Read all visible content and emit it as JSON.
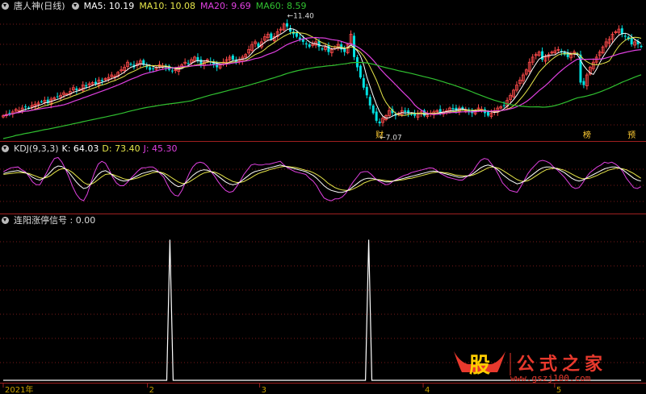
{
  "main_header": {
    "stock_name": "唐人神(日线)",
    "ma5": "MA5: 10.19",
    "ma10": "MA10: 10.08",
    "ma20": "MA20: 9.69",
    "ma60": "MA60: 8.59"
  },
  "kdj_header": {
    "title": "KDJ(9,3,3)",
    "k": "K: 64.03",
    "d": "D: 73.40",
    "j": "J: 45.30"
  },
  "signal_header": {
    "title": "连阳涨停信号 : 0.00"
  },
  "colors": {
    "up": "#ff4a4a",
    "down": "#00e0e0",
    "ma5": "#ffffff",
    "ma10": "#e6e64a",
    "ma20": "#e040e0",
    "ma60": "#30c030",
    "k": "#ffffff",
    "d": "#e6e64a",
    "j": "#e040e0",
    "grid": "#7a1a1a",
    "axis": "#a02020"
  },
  "chart_data": [
    {
      "type": "candlestick",
      "title": "唐人神(日线)",
      "price_range": [
        6.8,
        11.8
      ],
      "annotations": [
        {
          "label": "11.40",
          "value": 11.4,
          "index": 88
        },
        {
          "label": "7.07",
          "value": 7.07,
          "index": 117
        },
        {
          "label": "财",
          "index": 118
        },
        {
          "label": "榜",
          "index": 183
        },
        {
          "label": "预",
          "index": 197
        }
      ],
      "closes": [
        7.7,
        7.75,
        7.8,
        7.85,
        7.95,
        7.9,
        8.0,
        8.05,
        8.0,
        8.1,
        8.15,
        8.2,
        8.25,
        8.3,
        8.2,
        8.35,
        8.4,
        8.45,
        8.5,
        8.6,
        8.55,
        8.65,
        8.8,
        8.7,
        8.75,
        8.9,
        8.85,
        8.95,
        9.0,
        8.95,
        9.1,
        9.05,
        9.15,
        9.2,
        9.3,
        9.25,
        9.4,
        9.5,
        9.6,
        9.8,
        9.7,
        9.6,
        9.75,
        9.85,
        9.7,
        9.6,
        9.5,
        9.55,
        9.6,
        9.7,
        9.65,
        9.6,
        9.5,
        9.45,
        9.5,
        9.6,
        9.7,
        9.8,
        9.75,
        9.9,
        10.0,
        9.85,
        9.7,
        9.8,
        9.9,
        9.8,
        9.7,
        9.6,
        9.7,
        9.8,
        9.9,
        10.0,
        9.9,
        9.8,
        9.9,
        10.0,
        10.1,
        10.3,
        10.5,
        10.6,
        10.4,
        10.6,
        10.8,
        10.9,
        10.7,
        10.8,
        11.0,
        11.1,
        11.3,
        11.2,
        11.0,
        10.9,
        10.8,
        10.7,
        10.6,
        10.5,
        10.4,
        10.5,
        10.6,
        10.4,
        10.3,
        10.4,
        10.2,
        10.3,
        10.4,
        10.5,
        10.3,
        10.2,
        10.5,
        10.9,
        10.0,
        9.6,
        9.2,
        8.8,
        8.5,
        8.1,
        7.8,
        7.5,
        7.4,
        7.6,
        7.7,
        7.9,
        7.8,
        7.7,
        7.8,
        7.9,
        7.85,
        7.8,
        7.75,
        7.7,
        7.8,
        7.85,
        7.7,
        7.75,
        7.8,
        7.85,
        7.9,
        7.8,
        7.85,
        7.9,
        8.0,
        7.95,
        7.9,
        8.0,
        7.95,
        7.9,
        7.85,
        7.8,
        7.9,
        8.0,
        7.95,
        7.8,
        7.7,
        7.8,
        7.9,
        8.0,
        8.05,
        8.1,
        8.3,
        8.5,
        8.7,
        8.9,
        9.1,
        9.3,
        9.5,
        9.8,
        10.0,
        10.1,
        10.2,
        9.9,
        10.0,
        10.1,
        10.2,
        10.25,
        10.3,
        10.2,
        10.1,
        10.0,
        10.1,
        10.2,
        10.1,
        9.0,
        8.9,
        9.3,
        9.6,
        9.8,
        10.0,
        10.2,
        10.4,
        10.6,
        10.7,
        10.9,
        11.0,
        11.1,
        10.9,
        10.8,
        10.7,
        10.5,
        10.6,
        10.5,
        10.4
      ]
    },
    {
      "type": "line",
      "title": "KDJ(9,3,3)",
      "series": [
        {
          "name": "K"
        },
        {
          "name": "D"
        },
        {
          "name": "J"
        }
      ],
      "ylim": [
        -10,
        110
      ],
      "k": [
        70,
        72,
        74,
        75,
        76,
        74,
        72,
        68,
        62,
        58,
        56,
        60,
        66,
        74,
        82,
        86,
        85,
        80,
        72,
        62,
        52,
        44,
        38,
        40,
        48,
        58,
        68,
        74,
        76,
        72,
        66,
        60,
        56,
        54,
        55,
        58,
        62,
        66,
        70,
        72,
        74,
        76,
        75,
        72,
        68,
        60,
        52,
        46,
        42,
        44,
        50,
        58,
        66,
        72,
        76,
        78,
        77,
        74,
        70,
        64,
        58,
        52,
        48,
        46,
        48,
        52,
        58,
        64,
        70,
        74,
        76,
        78,
        80,
        82,
        84,
        86,
        88,
        86,
        84,
        82,
        80,
        78,
        76,
        74,
        70,
        66,
        60,
        52,
        44,
        38,
        34,
        32,
        30,
        30,
        32,
        36,
        42,
        48,
        54,
        58,
        60,
        60,
        58,
        56,
        54,
        52,
        52,
        54,
        56,
        58,
        60,
        62,
        64,
        66,
        68,
        70,
        72,
        74,
        75,
        74,
        72,
        70,
        68,
        66,
        64,
        62,
        62,
        64,
        66,
        70,
        76,
        82,
        86,
        88,
        86,
        82,
        76,
        68,
        62,
        56,
        52,
        48,
        50,
        54,
        60,
        66,
        72,
        78,
        82,
        84,
        84,
        82,
        80,
        76,
        72,
        66,
        60,
        56,
        54,
        56,
        60,
        64,
        68,
        72,
        76,
        80,
        82,
        84,
        84,
        82,
        78,
        72,
        66,
        60,
        56,
        54
      ],
      "d": [
        68,
        69,
        70,
        71,
        72,
        72,
        71,
        70,
        67,
        64,
        61,
        60,
        62,
        66,
        72,
        77,
        80,
        80,
        77,
        72,
        65,
        58,
        51,
        47,
        47,
        51,
        57,
        63,
        68,
        69,
        68,
        65,
        62,
        59,
        57,
        57,
        59,
        61,
        64,
        67,
        69,
        72,
        73,
        73,
        71,
        67,
        62,
        57,
        52,
        49,
        49,
        52,
        57,
        62,
        67,
        71,
        73,
        74,
        73,
        70,
        66,
        61,
        57,
        53,
        51,
        51,
        53,
        57,
        61,
        66,
        70,
        73,
        75,
        78,
        80,
        82,
        84,
        85,
        85,
        84,
        83,
        81,
        79,
        77,
        75,
        72,
        68,
        63,
        57,
        50,
        45,
        40,
        37,
        35,
        34,
        34,
        37,
        41,
        45,
        50,
        53,
        56,
        57,
        57,
        56,
        55,
        54,
        54,
        55,
        56,
        57,
        59,
        60,
        62,
        64,
        66,
        68,
        70,
        72,
        73,
        73,
        72,
        71,
        69,
        67,
        66,
        65,
        65,
        65,
        67,
        70,
        74,
        78,
        82,
        84,
        83,
        81,
        77,
        72,
        67,
        62,
        57,
        54,
        53,
        55,
        59,
        64,
        69,
        74,
        78,
        80,
        81,
        81,
        79,
        77,
        73,
        69,
        65,
        61,
        59,
        59,
        60,
        63,
        66,
        70,
        73,
        77,
        79,
        81,
        81,
        80,
        78,
        74,
        70,
        65,
        60
      ],
      "j": [
        74,
        78,
        82,
        83,
        84,
        78,
        74,
        64,
        52,
        46,
        46,
        60,
        74,
        90,
        102,
        104,
        95,
        80,
        62,
        42,
        26,
        16,
        12,
        26,
        50,
        72,
        90,
        96,
        92,
        78,
        62,
        50,
        44,
        44,
        51,
        60,
        68,
        76,
        82,
        82,
        84,
        84,
        79,
        70,
        62,
        46,
        32,
        24,
        22,
        34,
        52,
        70,
        84,
        92,
        94,
        92,
        85,
        74,
        64,
        52,
        42,
        34,
        30,
        32,
        42,
        54,
        68,
        78,
        88,
        90,
        88,
        88,
        90,
        90,
        92,
        94,
        96,
        88,
        82,
        78,
        74,
        72,
        70,
        68,
        60,
        54,
        44,
        30,
        18,
        14,
        12,
        16,
        16,
        20,
        28,
        40,
        52,
        62,
        72,
        74,
        74,
        68,
        60,
        54,
        50,
        46,
        48,
        54,
        58,
        62,
        66,
        68,
        72,
        74,
        76,
        78,
        80,
        82,
        81,
        76,
        70,
        66,
        62,
        60,
        58,
        56,
        56,
        62,
        68,
        76,
        88,
        98,
        102,
        100,
        90,
        80,
        66,
        50,
        42,
        34,
        32,
        30,
        42,
        56,
        70,
        80,
        88,
        96,
        98,
        96,
        92,
        84,
        78,
        70,
        62,
        52,
        42,
        38,
        40,
        50,
        62,
        72,
        78,
        84,
        88,
        94,
        92,
        94,
        90,
        84,
        74,
        60,
        50,
        40,
        38,
        42
      ]
    },
    {
      "type": "line",
      "title": "连阳涨停信号",
      "ylim": [
        0,
        1.1
      ],
      "spikes_at": [
        52,
        114
      ],
      "n": 200,
      "x_ticks": [
        {
          "label": "2021年",
          "index": 0
        },
        {
          "label": "2",
          "index": 45
        },
        {
          "label": "3",
          "index": 80
        },
        {
          "label": "4",
          "index": 131
        },
        {
          "label": "5",
          "index": 172
        }
      ]
    }
  ],
  "watermark": {
    "glyph": "股",
    "text": "公式之家",
    "url": "www.gszj100.com"
  }
}
